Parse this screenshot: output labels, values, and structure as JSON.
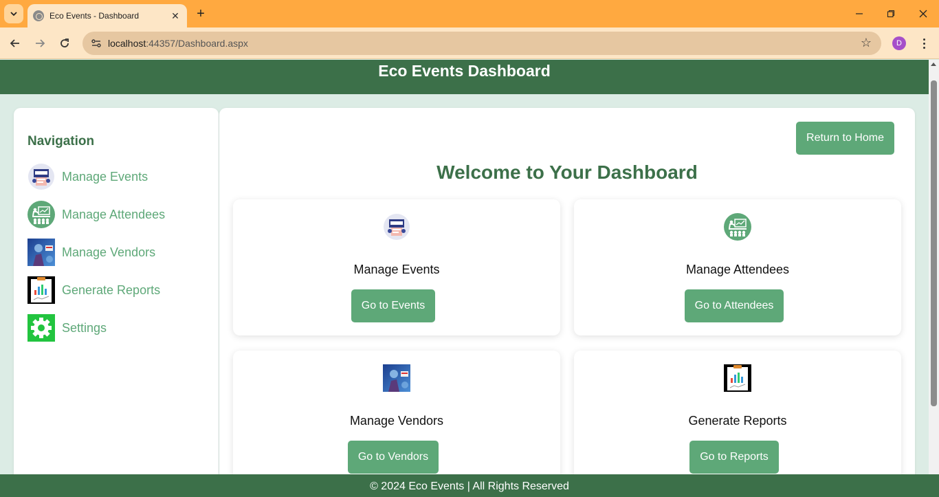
{
  "browser": {
    "tab_title": "Eco Events - Dashboard",
    "url_host": "localhost",
    "url_rest": ":44357/Dashboard.aspx",
    "profile_initial": "D"
  },
  "header": {
    "title": "Eco Events Dashboard"
  },
  "sidebar": {
    "heading": "Navigation",
    "items": [
      {
        "label": "Manage Events",
        "icon": "event-icon"
      },
      {
        "label": "Manage Attendees",
        "icon": "attendees-icon"
      },
      {
        "label": "Manage Vendors",
        "icon": "vendors-icon"
      },
      {
        "label": "Generate Reports",
        "icon": "reports-icon"
      },
      {
        "label": "Settings",
        "icon": "gear-icon"
      }
    ]
  },
  "main": {
    "return_label": "Return to Home",
    "welcome": "Welcome to Your Dashboard",
    "cards": [
      {
        "title": "Manage Events",
        "button": "Go to Events",
        "icon": "event-icon"
      },
      {
        "title": "Manage Attendees",
        "button": "Go to Attendees",
        "icon": "attendees-icon"
      },
      {
        "title": "Manage Vendors",
        "button": "Go to Vendors",
        "icon": "vendors-icon"
      },
      {
        "title": "Generate Reports",
        "button": "Go to Reports",
        "icon": "reports-icon"
      }
    ]
  },
  "footer": {
    "text": "© 2024 Eco Events | All Rights Reserved"
  },
  "colors": {
    "brand_dark": "#3c7049",
    "brand_button": "#5ea878",
    "page_bg": "#dcece5",
    "tabbar": "#ffa940"
  }
}
